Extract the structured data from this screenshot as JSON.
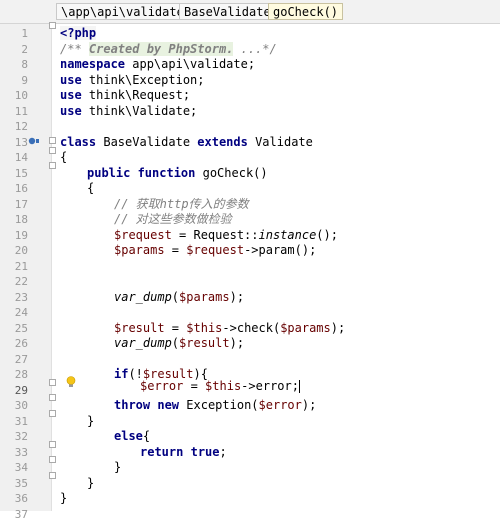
{
  "breadcrumb": [
    {
      "label": "\\app\\api\\validate",
      "active": false
    },
    {
      "label": "BaseValidate",
      "active": false
    },
    {
      "label": "goCheck()",
      "active": true
    }
  ],
  "editor": {
    "highlighted_line": "29",
    "lines": [
      {
        "no": "1"
      },
      {
        "no": "2"
      },
      {
        "no": "8"
      },
      {
        "no": "9"
      },
      {
        "no": "10"
      },
      {
        "no": "11"
      },
      {
        "no": "12"
      },
      {
        "no": "13"
      },
      {
        "no": "14"
      },
      {
        "no": "15"
      },
      {
        "no": "16"
      },
      {
        "no": "17"
      },
      {
        "no": "18"
      },
      {
        "no": "19"
      },
      {
        "no": "20"
      },
      {
        "no": "21"
      },
      {
        "no": "22"
      },
      {
        "no": "23"
      },
      {
        "no": "24"
      },
      {
        "no": "25"
      },
      {
        "no": "26"
      },
      {
        "no": "27"
      },
      {
        "no": "28"
      },
      {
        "no": "29"
      },
      {
        "no": "30"
      },
      {
        "no": "31"
      },
      {
        "no": "32"
      },
      {
        "no": "33"
      },
      {
        "no": "34"
      },
      {
        "no": "35"
      },
      {
        "no": "36"
      },
      {
        "no": "37"
      }
    ],
    "tokens": {
      "l1": "<?php",
      "l2_doc": "/** ",
      "l2_tag": "Created by PhpStorm.",
      "l2_end": " ...*/",
      "l8_kw": "namespace",
      "l8_rest": " app\\api\\validate;",
      "l9_kw": "use",
      "l9_rest": " think\\Exception;",
      "l10_kw": "use",
      "l10_rest": " think\\Request;",
      "l11_kw": "use",
      "l11_rest": " think\\Validate;",
      "l13_kw1": "class",
      "l13_name": " BaseValidate ",
      "l13_kw2": "extends",
      "l13_parent": " Validate",
      "l14": "{",
      "l15_kw": "public function",
      "l15_rest": " goCheck()",
      "l16": "{",
      "l17": "// 获取http传入的参数",
      "l18": "// 对这些参数做检验",
      "l19_var": "$request",
      "l19_mid": " = Request::",
      "l19_fn": "instance",
      "l19_end": "();",
      "l20_var": "$params",
      "l20_mid": " = ",
      "l20_var2": "$request",
      "l20_end": "->param();",
      "l23_fn": "var_dump",
      "l23_open": "(",
      "l23_var": "$params",
      "l23_end": ");",
      "l25_var": "$result",
      "l25_mid": " = ",
      "l25_var2": "$this",
      "l25_mid2": "->check(",
      "l25_var3": "$params",
      "l25_end": ");",
      "l26_fn": "var_dump",
      "l26_open": "(",
      "l26_var": "$result",
      "l26_end": ");",
      "l28_kw": "if",
      "l28_open": "(!",
      "l28_var": "$result",
      "l28_end": "){",
      "l29_var": "$error",
      "l29_mid": " = ",
      "l29_var2": "$this",
      "l29_end": "->error;",
      "l30_kw1": "throw",
      "l30_sp": " ",
      "l30_kw2": "new",
      "l30_mid": " Exception(",
      "l30_var": "$error",
      "l30_end": ");",
      "l31": "}",
      "l32_kw": "else",
      "l32_end": "{",
      "l33_kw1": "return",
      "l33_sp": " ",
      "l33_kw2": "true",
      "l33_end": ";",
      "l34": "}",
      "l35": "}",
      "l36": "}"
    }
  },
  "colors": {
    "keyword": "#000080",
    "variable": "#660000",
    "comment": "#808080",
    "highlight_row": "#fffae3",
    "gutter": "#f0f0f0"
  },
  "icons": [
    "debug-class-icon",
    "lightbulb-icon",
    "fold-marker-icon"
  ]
}
